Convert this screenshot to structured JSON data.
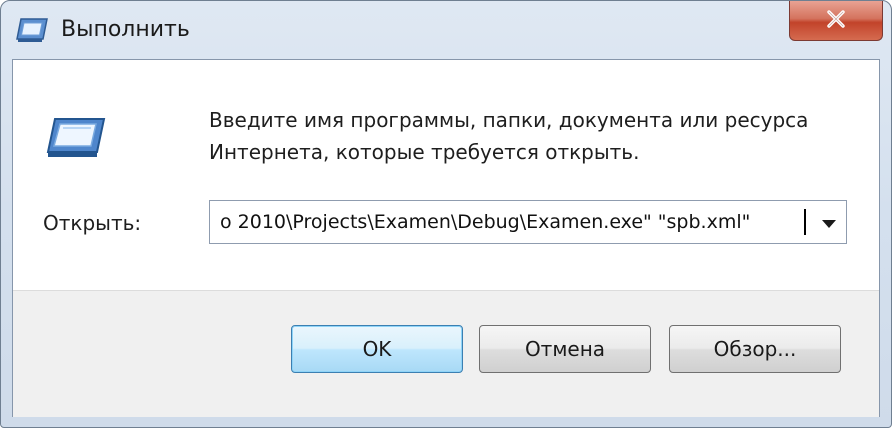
{
  "window": {
    "title": "Выполнить",
    "title_icon": "run-icon",
    "close_icon": "close-icon"
  },
  "dialog": {
    "icon": "run-program-icon",
    "prompt": "Введите имя программы, папки, документа или ресурса Интернета, которые требуется открыть.",
    "open_label": "Открыть:",
    "open_value": "o 2010\\Projects\\Examen\\Debug\\Examen.exe\" \"spb.xml\"",
    "dropdown_icon": "chevron-down-icon"
  },
  "buttons": {
    "ok": "OK",
    "cancel": "Отмена",
    "browse": "Обзор..."
  },
  "colors": {
    "frame": "#d4e0ee",
    "close": "#c2432a",
    "default_button_border": "#3c7fb1"
  }
}
